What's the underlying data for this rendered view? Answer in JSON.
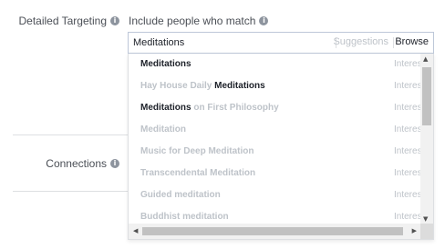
{
  "form": {
    "detailed_targeting_label": "Detailed Targeting",
    "include_label": "Include people who match",
    "connections_label": "Connections",
    "info_icon_glyph": "i"
  },
  "search": {
    "value": "Meditations",
    "suggestions_label": "Suggestions",
    "browse_label": "Browse"
  },
  "suggestions": [
    {
      "pre": "",
      "match": "Meditations",
      "post": "",
      "category": "Interes",
      "pre_dim": false
    },
    {
      "pre": "Hay House Daily ",
      "match": "Meditations",
      "post": "",
      "category": "Interes",
      "pre_dim": true
    },
    {
      "pre": "",
      "match": "Meditations",
      "post": " on First Philosophy",
      "category": "Interes",
      "pre_dim": false
    },
    {
      "pre": "",
      "match": "",
      "post": "Meditation",
      "category": "Interes",
      "pre_dim": false
    },
    {
      "pre": "",
      "match": "",
      "post": "Music for Deep Meditation",
      "category": "Interes",
      "pre_dim": false
    },
    {
      "pre": "",
      "match": "",
      "post": "Transcendental Meditation",
      "category": "Interes",
      "pre_dim": false
    },
    {
      "pre": "",
      "match": "",
      "post": "Guided meditation",
      "category": "Interes",
      "pre_dim": false
    },
    {
      "pre": "",
      "match": "",
      "post": "Buddhist meditation",
      "category": "Interes",
      "pre_dim": false
    }
  ],
  "scrollbar": {
    "up": "▲",
    "down": "▼",
    "left": "◀",
    "right": "▶"
  },
  "colors": {
    "highlight_text": "#1d2129",
    "muted_text": "#bec3c9",
    "label_text": "#4b4f56"
  }
}
